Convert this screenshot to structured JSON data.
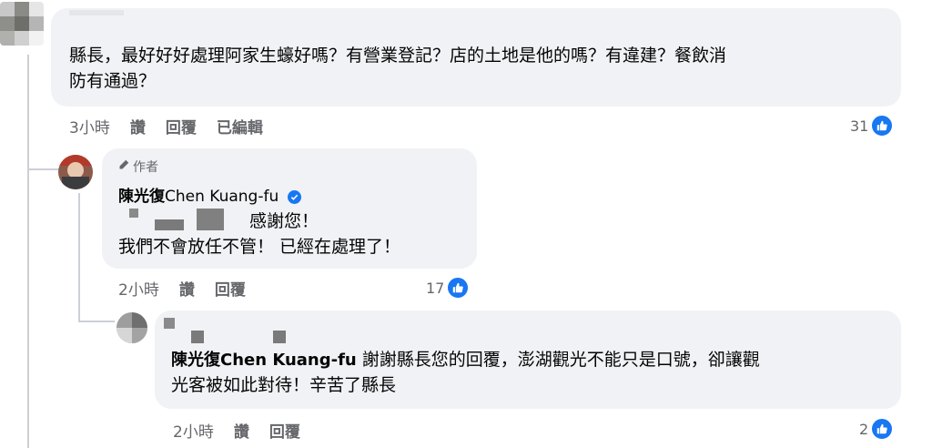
{
  "comment1": {
    "text_line1": "縣長，最好好好處理阿家生蠔好嗎？有營業登記？店的土地是他的嗎？有違建？餐飲消",
    "text_line2": "防有通過？",
    "actions": {
      "time": "3小時",
      "like": "讚",
      "reply": "回覆",
      "edited": "已編輯"
    },
    "like_count": "31"
  },
  "reply1": {
    "author_badge": "作者",
    "author_name": "陳光復",
    "author_name_latin": "Chen Kuang-fu",
    "text_line1": "感謝您！",
    "text_line2": "我們不會放任不管！ 已經在處理了！",
    "actions": {
      "time": "2小時",
      "like": "讚",
      "reply": "回覆"
    },
    "like_count": "17"
  },
  "reply2": {
    "mention": "陳光復Chen Kuang-fu",
    "text_line1_rest": " 謝謝縣長您的回覆，澎湖觀光不能只是口號，卻讓觀",
    "text_line2": "光客被如此對待！辛苦了縣長",
    "actions": {
      "time": "2小時",
      "like": "讚",
      "reply": "回覆"
    },
    "like_count": "2"
  },
  "colors": {
    "accent": "#1877f2",
    "bubble": "#f0f2f5",
    "secondary_text": "#65676b"
  },
  "icons": {
    "like": "thumbs-up-icon",
    "verified": "verified-check-icon",
    "author": "pencil-icon"
  }
}
